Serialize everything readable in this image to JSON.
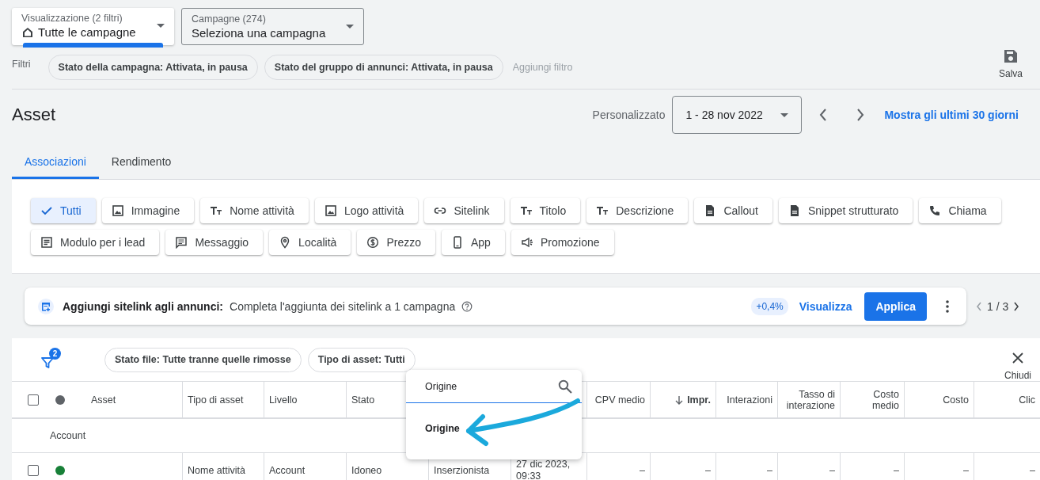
{
  "view_selector": {
    "label": "Visualizzazione (2 filtri)",
    "value": "Tutte le campagne"
  },
  "campaign_selector": {
    "label": "Campagne (274)",
    "value": "Seleziona una campagna"
  },
  "filters": {
    "label": "Filtri",
    "chips": [
      "Stato della campagna: Attivata, in pausa",
      "Stato del gruppo di annunci: Attivata, in pausa"
    ],
    "add": "Aggiungi filtro"
  },
  "save": "Salva",
  "page_title": "Asset",
  "date": {
    "label": "Personalizzato",
    "range": "1 - 28 nov 2022",
    "show_last": "Mostra gli ultimi 30 giorni"
  },
  "tabs": [
    {
      "label": "Associazioni",
      "selected": true
    },
    {
      "label": "Rendimento",
      "selected": false
    }
  ],
  "asset_types": [
    {
      "label": "Tutti",
      "selected": true
    },
    {
      "label": "Immagine",
      "selected": false
    },
    {
      "label": "Nome attività",
      "selected": false
    },
    {
      "label": "Logo attività",
      "selected": false
    },
    {
      "label": "Sitelink",
      "selected": false
    },
    {
      "label": "Titolo",
      "selected": false
    },
    {
      "label": "Descrizione",
      "selected": false
    },
    {
      "label": "Callout",
      "selected": false
    },
    {
      "label": "Snippet strutturato",
      "selected": false
    },
    {
      "label": "Chiama",
      "selected": false
    },
    {
      "label": "Modulo per i lead",
      "selected": false
    },
    {
      "label": "Messaggio",
      "selected": false
    },
    {
      "label": "Località",
      "selected": false
    },
    {
      "label": "Prezzo",
      "selected": false
    },
    {
      "label": "App",
      "selected": false
    },
    {
      "label": "Promozione",
      "selected": false
    }
  ],
  "recommendation": {
    "title": "Aggiungi sitelink agli annunci:",
    "text": "Completa l'aggiunta dei sitelink a 1 campagna",
    "uplift": "+0,4%",
    "view": "Visualizza",
    "apply": "Applica",
    "pager": "1 / 3"
  },
  "table_filters": {
    "count": "2",
    "chips": [
      "Stato file: Tutte tranne quelle rimosse",
      "Tipo di asset: Tutti"
    ],
    "close": "Chiudi"
  },
  "table": {
    "header_checked": false,
    "columns_left": [
      {
        "label": "Asset",
        "sorted": false
      },
      {
        "label": "Tipo di asset",
        "sorted": false
      },
      {
        "label": "Livello",
        "sorted": false
      },
      {
        "label": "Stato",
        "sorted": false
      }
    ],
    "columns_right": [
      {
        "label": "CPV medio",
        "sorted": false
      },
      {
        "label": "Impr.",
        "sorted": true
      },
      {
        "label": "Interazioni",
        "sorted": false
      },
      {
        "label": "Tasso di interazione",
        "sorted": false
      },
      {
        "label": "Costo medio",
        "sorted": false
      },
      {
        "label": "Costo",
        "sorted": false
      },
      {
        "label": "Clic",
        "sorted": false
      }
    ],
    "group": "Account",
    "rows": [
      {
        "checked": false,
        "color": "#188038",
        "cells": [
          "Nome attività",
          "Account",
          "Idoneo",
          "Inserzionista",
          "27 dic 2023, 09:33",
          "–",
          "–",
          "–",
          "–",
          "–",
          "–",
          "–"
        ]
      }
    ]
  },
  "column_search": {
    "value": "Origine",
    "options": [
      "Origine"
    ]
  }
}
